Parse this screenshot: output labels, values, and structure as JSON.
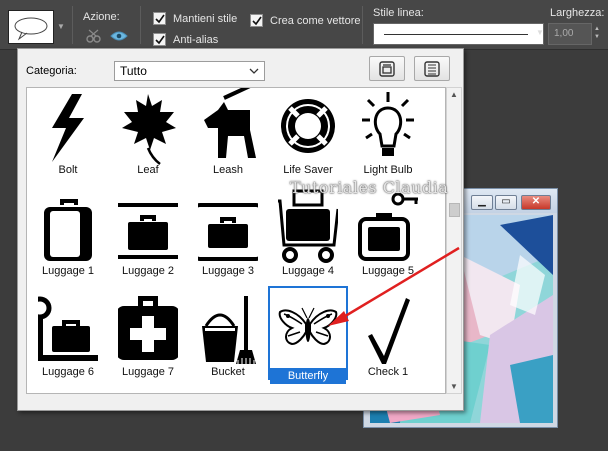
{
  "toolbar": {
    "action_label": "Azione:",
    "keep_style_label": "Mantieni stile",
    "antialias_label": "Anti-alias",
    "create_vector_label": "Crea come vettore",
    "line_style_label": "Stile linea:",
    "width_label": "Larghezza:",
    "width_value": "1,00"
  },
  "picker": {
    "category_label": "Categoria:",
    "category_value": "Tutto",
    "shapes": [
      {
        "label": "Bolt",
        "icon": "bolt-icon"
      },
      {
        "label": "Leaf",
        "icon": "leaf-icon"
      },
      {
        "label": "Leash",
        "icon": "leash-icon"
      },
      {
        "label": "Life Saver",
        "icon": "life-saver-icon"
      },
      {
        "label": "Light Bulb",
        "icon": "light-bulb-icon"
      },
      {
        "label": "Luggage 1",
        "icon": "luggage-1-icon"
      },
      {
        "label": "Luggage 2",
        "icon": "luggage-2-icon"
      },
      {
        "label": "Luggage 3",
        "icon": "luggage-3-icon"
      },
      {
        "label": "Luggage 4",
        "icon": "luggage-4-icon"
      },
      {
        "label": "Luggage 5",
        "icon": "luggage-5-icon"
      },
      {
        "label": "Luggage 6",
        "icon": "luggage-6-icon"
      },
      {
        "label": "Luggage 7",
        "icon": "luggage-7-icon"
      },
      {
        "label": "Bucket",
        "icon": "bucket-icon"
      },
      {
        "label": "Butterfly",
        "icon": "butterfly-icon",
        "selected": true
      },
      {
        "label": "Check 1",
        "icon": "checkmark-icon"
      }
    ]
  },
  "watermark": "Tutoriales Claudia",
  "colors": {
    "selection": "#1e74d6",
    "annotation_arrow": "#e02020",
    "toolbar_bg": "#474747"
  }
}
